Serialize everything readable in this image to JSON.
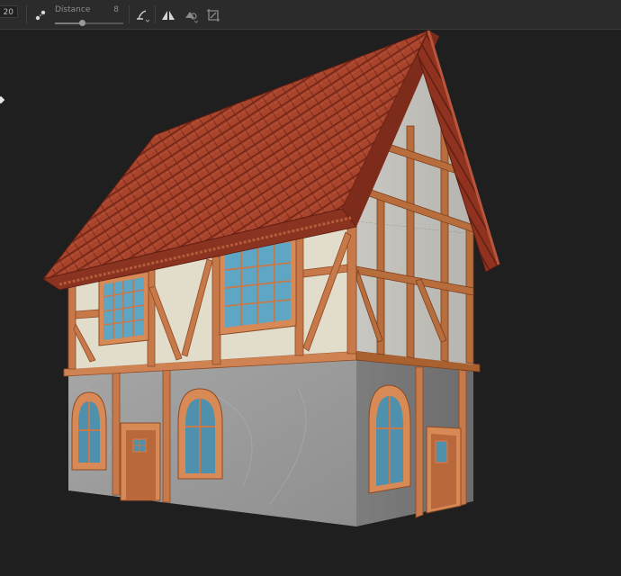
{
  "toolbar": {
    "size_value": "20",
    "distance": {
      "label": "Distance",
      "value": "8",
      "fraction": 0.4
    },
    "icons": [
      "scatter-points-icon",
      "curve-tool-icon",
      "mirror-symmetry-icon",
      "shape-tool-icon",
      "transform-tool-icon"
    ]
  },
  "viewport": {
    "background": "#1f1f1f",
    "model": "3d-timber-frame-house"
  },
  "colors": {
    "roof": "#a8442c",
    "timber": "#c7794a",
    "plaster": "#e2dccb",
    "stone": "#9b9b9b",
    "glass": "#5fa6c4"
  }
}
